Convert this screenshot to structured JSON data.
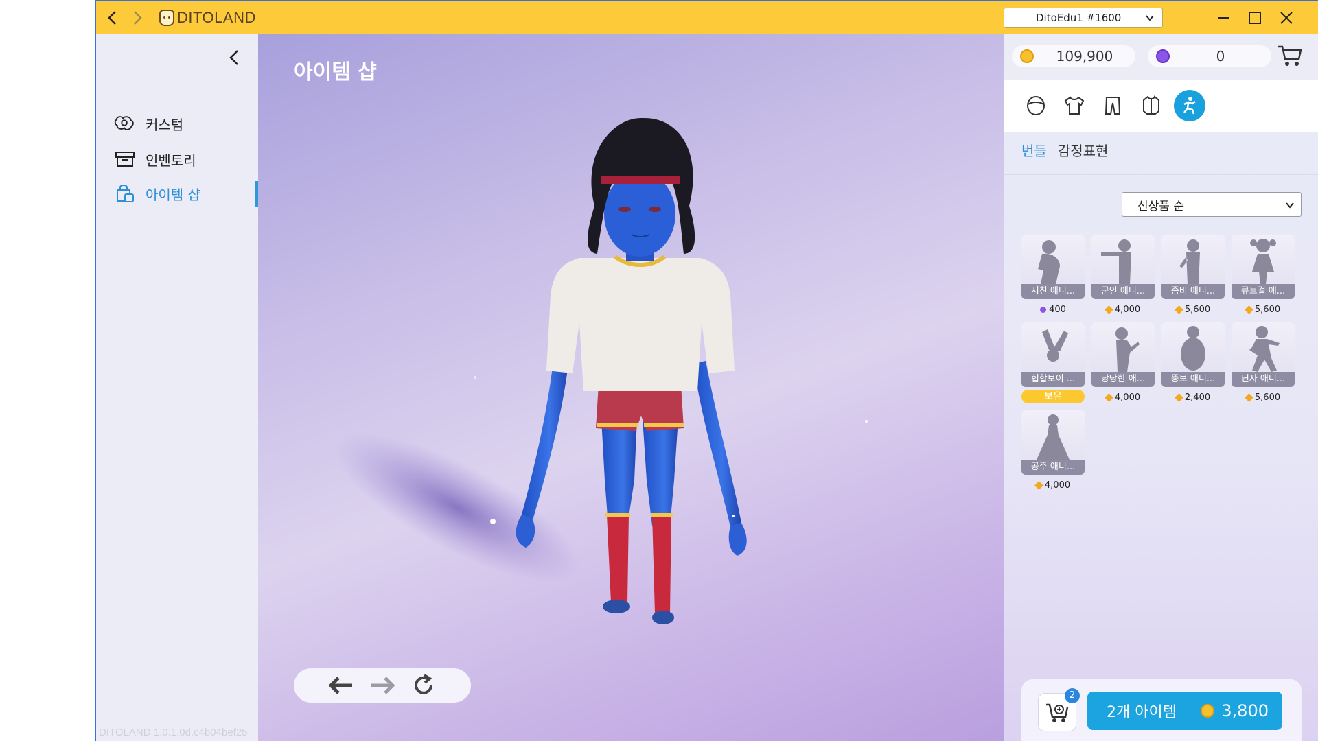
{
  "titlebar": {
    "app_name": "DITOLAND",
    "account": "DitoEdu1 #1600"
  },
  "sidebar": {
    "items": [
      {
        "label": "커스텀",
        "icon": "custom-icon"
      },
      {
        "label": "인벤토리",
        "icon": "inventory-icon"
      },
      {
        "label": "아이템 샵",
        "icon": "shop-bag-icon",
        "active": true
      }
    ],
    "version": "DITOLAND 1.0.1.0d.c4b04bef25"
  },
  "stage": {
    "title": "아이템 샵"
  },
  "currency": {
    "gold": "109,900",
    "gem": "0"
  },
  "tabs": [
    {
      "label": "번들",
      "active": true
    },
    {
      "label": "감정표현",
      "active": false
    }
  ],
  "sort": {
    "selected": "신상품 순"
  },
  "items": [
    {
      "name": "지친 애니...",
      "price": "400",
      "currency": "gem"
    },
    {
      "name": "군인 애니...",
      "price": "4,000",
      "currency": "gold"
    },
    {
      "name": "좀비 애니...",
      "price": "5,600",
      "currency": "gold"
    },
    {
      "name": "큐트걸 애...",
      "price": "5,600",
      "currency": "gold"
    },
    {
      "name": "힙합보이 ...",
      "owned": "보유"
    },
    {
      "name": "당당한 애...",
      "price": "4,000",
      "currency": "gold"
    },
    {
      "name": "뚱보 애니...",
      "price": "2,400",
      "currency": "gold"
    },
    {
      "name": "닌자 애니...",
      "price": "5,600",
      "currency": "gold"
    },
    {
      "name": "공주 애니...",
      "price": "4,000",
      "currency": "gold"
    }
  ],
  "cart": {
    "badge": "2",
    "count_label": "2개 아이템",
    "total": "3,800"
  },
  "colors": {
    "titlebar": "#fdcb3a",
    "accent": "#1ba4e0",
    "gold": "#f7c12e",
    "gem": "#8b55e8",
    "owned": "#fbc830"
  }
}
